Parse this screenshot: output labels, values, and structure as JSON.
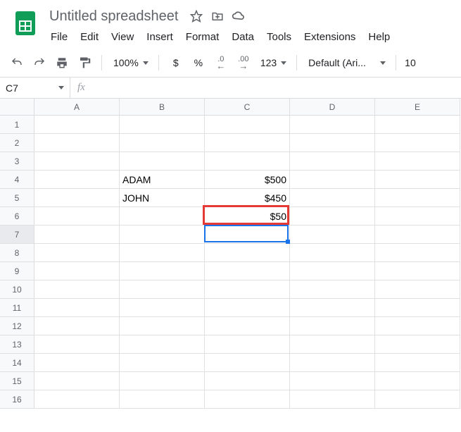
{
  "title": "Untitled spreadsheet",
  "menus": [
    "File",
    "Edit",
    "View",
    "Insert",
    "Format",
    "Data",
    "Tools",
    "Extensions",
    "Help"
  ],
  "toolbar": {
    "zoom": "100%",
    "currency": "$",
    "percent": "%",
    "dec_dec": ".0",
    "inc_dec": ".00",
    "more_fmt": "123",
    "font": "Default (Ari...",
    "fontsize": "10"
  },
  "namebox": "C7",
  "fx_label": "fx",
  "formula": "",
  "columns": [
    "A",
    "B",
    "C",
    "D",
    "E"
  ],
  "rows": 16,
  "active_row": 7,
  "data": {
    "B4": "ADAM",
    "C4": "$500",
    "B5": "JOHN",
    "C5": "$450",
    "C6": "$50"
  },
  "selection": {
    "col": 2,
    "row": 6
  },
  "highlight": {
    "col": 2,
    "row": 5
  }
}
